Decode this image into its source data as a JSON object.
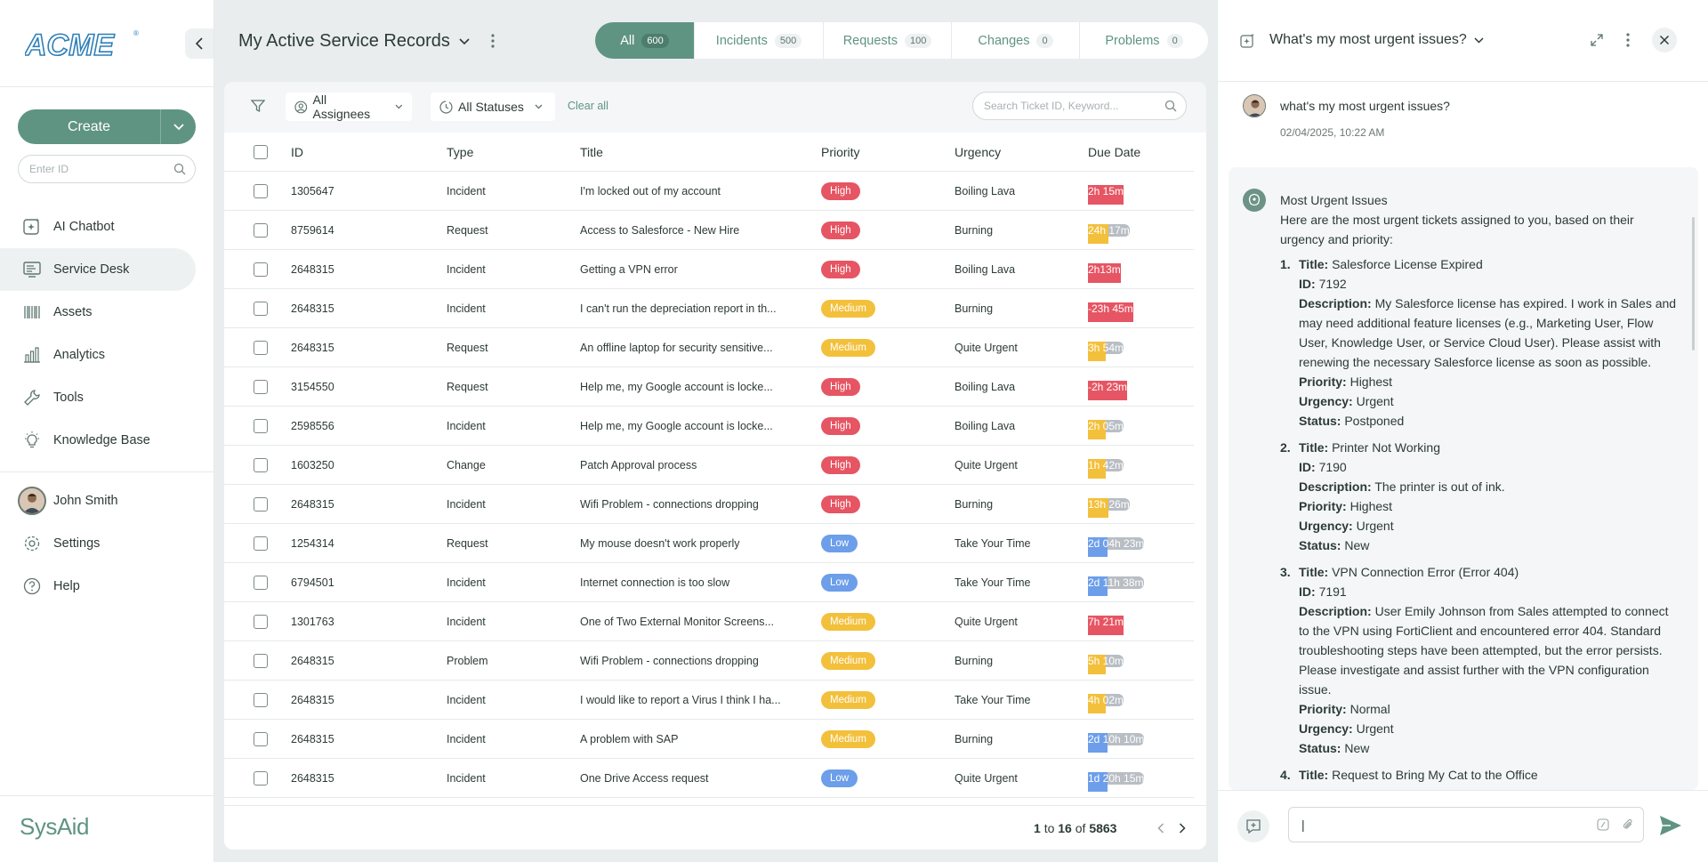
{
  "app": {
    "brand": "ACME",
    "footer_brand": "SysAid",
    "accent_color": "#5f9482"
  },
  "sidebar": {
    "create_label": "Create",
    "id_placeholder": "Enter ID",
    "items": [
      {
        "label": "AI Chatbot",
        "icon": "ai-sparkle-icon"
      },
      {
        "label": "Service Desk",
        "icon": "service-desk-icon",
        "active": true
      },
      {
        "label": "Assets",
        "icon": "barcode-icon"
      },
      {
        "label": "Analytics",
        "icon": "bar-chart-icon"
      },
      {
        "label": "Tools",
        "icon": "wrench-icon"
      },
      {
        "label": "Knowledge Base",
        "icon": "lightbulb-icon"
      }
    ],
    "user_name": "John Smith",
    "settings_label": "Settings",
    "help_label": "Help"
  },
  "header": {
    "title": "My Active Service Records"
  },
  "tabs": [
    {
      "label": "All",
      "count": "600"
    },
    {
      "label": "Incidents",
      "count": "500"
    },
    {
      "label": "Requests",
      "count": "100"
    },
    {
      "label": "Changes",
      "count": "0"
    },
    {
      "label": "Problems",
      "count": "0"
    }
  ],
  "filters": {
    "assignees": "All Assignees",
    "statuses": "All Statuses",
    "clear": "Clear all",
    "search_placeholder": "Search Ticket ID, Keyword..."
  },
  "table": {
    "columns": [
      "ID",
      "Type",
      "Title",
      "Priority",
      "Urgency",
      "Due Date"
    ],
    "rows": [
      {
        "id": "1305647",
        "type": "Incident",
        "title": "I'm locked out of my account",
        "priority": "High",
        "urgency": "Boiling Lava",
        "due": "2h 15m",
        "due_color": "#e65563",
        "due_fill": 1.0
      },
      {
        "id": "8759614",
        "type": "Request",
        "title": "Access to Salesforce - New Hire",
        "priority": "High",
        "urgency": "Burning",
        "due": "24h 17m",
        "due_color": "#f3c03b",
        "due_fill": 0.5
      },
      {
        "id": "2648315",
        "type": "Incident",
        "title": "Getting a VPN error",
        "priority": "High",
        "urgency": "Boiling Lava",
        "due": "2h13m",
        "due_color": "#e65563",
        "due_fill": 1.0
      },
      {
        "id": "2648315",
        "type": "Incident",
        "title": "I can't run the depreciation report in th...",
        "priority": "Medium",
        "urgency": "Burning",
        "due": "-23h 45m",
        "due_color": "#e65563",
        "due_fill": 1.0
      },
      {
        "id": "2648315",
        "type": "Request",
        "title": "An offline laptop for security sensitive...",
        "priority": "Medium",
        "urgency": "Quite Urgent",
        "due": "3h 54m",
        "due_color": "#f3c03b",
        "due_fill": 0.5
      },
      {
        "id": "3154550",
        "type": "Request",
        "title": "Help me, my Google account is locke...",
        "priority": "High",
        "urgency": "Boiling Lava",
        "due": "-2h 23m",
        "due_color": "#e65563",
        "due_fill": 1.0
      },
      {
        "id": "2598556",
        "type": "Incident",
        "title": "Help me, my Google account is locke...",
        "priority": "High",
        "urgency": "Boiling Lava",
        "due": "2h 05m",
        "due_color": "#f3c03b",
        "due_fill": 0.5
      },
      {
        "id": "1603250",
        "type": "Change",
        "title": "Patch Approval process",
        "priority": "High",
        "urgency": "Quite Urgent",
        "due": "1h 42m",
        "due_color": "#f3c03b",
        "due_fill": 0.5
      },
      {
        "id": "2648315",
        "type": "Incident",
        "title": "Wifi Problem - connections dropping",
        "priority": "High",
        "urgency": "Burning",
        "due": "13h 26m",
        "due_color": "#f3c03b",
        "due_fill": 0.5
      },
      {
        "id": "1254314",
        "type": "Request",
        "title": "My mouse doesn't work properly",
        "priority": "Low",
        "urgency": "Take Your Time",
        "due": "2d 04h 23m",
        "due_color": "#6c9eea",
        "due_fill": 0.35
      },
      {
        "id": "6794501",
        "type": "Incident",
        "title": "Internet connection is too slow",
        "priority": "Low",
        "urgency": "Take Your Time",
        "due": "2d 11h 38m",
        "due_color": "#6c9eea",
        "due_fill": 0.35
      },
      {
        "id": "1301763",
        "type": "Incident",
        "title": "One of Two External Monitor Screens...",
        "priority": "Medium",
        "urgency": "Quite Urgent",
        "due": "7h 21m",
        "due_color": "#e65563",
        "due_fill": 1.0
      },
      {
        "id": "2648315",
        "type": "Problem",
        "title": "Wifi Problem - connections dropping",
        "priority": "Medium",
        "urgency": "Burning",
        "due": "5h 10m",
        "due_color": "#f3c03b",
        "due_fill": 0.5
      },
      {
        "id": "2648315",
        "type": "Incident",
        "title": "I would like to report a Virus I think I ha...",
        "priority": "Medium",
        "urgency": "Take Your Time",
        "due": "4h 02m",
        "due_color": "#f3c03b",
        "due_fill": 0.5
      },
      {
        "id": "2648315",
        "type": "Incident",
        "title": "A problem with SAP",
        "priority": "Medium",
        "urgency": "Burning",
        "due": "2d 10h 10m",
        "due_color": "#6c9eea",
        "due_fill": 0.35
      },
      {
        "id": "2648315",
        "type": "Incident",
        "title": " One Drive Access request",
        "priority": "Low",
        "urgency": "Quite Urgent",
        "due": "1d 20h 15m",
        "due_color": "#6c9eea",
        "due_fill": 0.35
      }
    ]
  },
  "pagination": {
    "from": "1",
    "to_word": "to",
    "to": "16",
    "of_word": "of",
    "total": "5863"
  },
  "chat": {
    "title": "What's my most urgent issues?",
    "user_message": "what's my most urgent issues?",
    "user_time": "02/04/2025, 10:22 AM",
    "bot_heading": "Most Urgent Issues",
    "bot_intro": "Here are the most urgent tickets assigned to you, based on their urgency and priority:",
    "labels": {
      "title": "Title:",
      "id": "ID:",
      "description": "Description:",
      "priority": "Priority:",
      "urgency": "Urgency:",
      "status": "Status:"
    },
    "issues": [
      {
        "num": "1.",
        "title": "Salesforce License Expired",
        "id": "7192",
        "description": "My Salesforce license has expired. I work in Sales and may need additional feature licenses (e.g., Marketing User, Flow User, Knowledge User, or Service Cloud User). Please assist with renewing the necessary Salesforce license as soon as possible.",
        "priority": "Highest",
        "urgency": "Urgent",
        "status": "Postponed"
      },
      {
        "num": "2.",
        "title": "Printer Not Working",
        "id": "7190",
        "description": "The printer is out of ink.",
        "priority": "Highest",
        "urgency": "Urgent",
        "status": "New"
      },
      {
        "num": "3.",
        "title": "VPN Connection Error (Error 404)",
        "id": "7191",
        "description": "User Emily Johnson from Sales attempted to connect to the VPN using FortiClient and encountered error 404. Standard troubleshooting steps have been attempted, but the error persists. Please investigate and assist further with the VPN configuration issue.",
        "priority": "Normal",
        "urgency": "Urgent",
        "status": "New"
      },
      {
        "num": "4.",
        "title": "Request to Bring My Cat to the Office"
      }
    ],
    "input_value": "|"
  }
}
